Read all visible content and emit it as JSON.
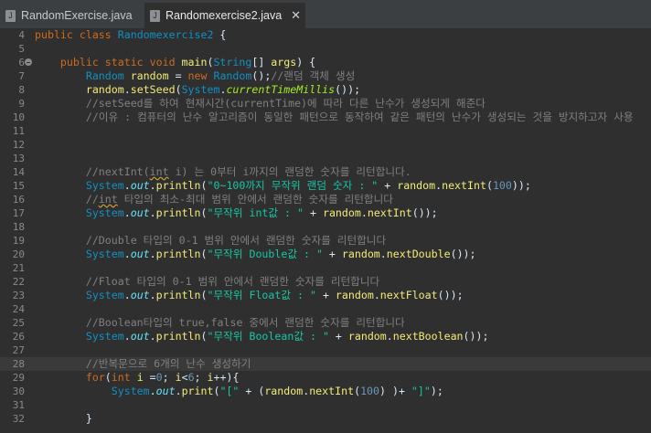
{
  "tabs": [
    {
      "label": "RandomExercise.java",
      "active": false
    },
    {
      "label": "Randomexercise2.java",
      "active": true
    }
  ],
  "colors": {
    "keyword": "#cc6c1d",
    "type": "#1290c3",
    "comment": "#808080",
    "string": "#17c6a3",
    "number": "#6897bb",
    "variable": "#f3ec79",
    "static_field": "#66e1f8",
    "static_method": "#a7ec21"
  },
  "editor": {
    "current_line": 28,
    "fold_marker_line": 6,
    "lines": [
      {
        "n": "4",
        "t": [
          [
            "kw",
            "public class "
          ],
          [
            "ty",
            "Randomexercise2"
          ],
          [
            "pl",
            " {"
          ]
        ]
      },
      {
        "n": "5",
        "t": []
      },
      {
        "n": "6",
        "t": [
          [
            "kw",
            "    public static void "
          ],
          [
            "va",
            "main"
          ],
          [
            "pl",
            "("
          ],
          [
            "ty",
            "String"
          ],
          [
            "pl",
            "[] "
          ],
          [
            "va",
            "args"
          ],
          [
            "pl",
            ") {"
          ]
        ]
      },
      {
        "n": "7",
        "t": [
          [
            "ty",
            "        Random "
          ],
          [
            "va",
            "random"
          ],
          [
            "pl",
            " = "
          ],
          [
            "kw",
            "new "
          ],
          [
            "ty",
            "Random"
          ],
          [
            "pl",
            "();"
          ],
          [
            "cm",
            "//랜덤 객체 생성"
          ]
        ]
      },
      {
        "n": "8",
        "t": [
          [
            "va",
            "        random"
          ],
          [
            "pl",
            "."
          ],
          [
            "va",
            "setSeed"
          ],
          [
            "pl",
            "("
          ],
          [
            "ty",
            "System"
          ],
          [
            "pl",
            "."
          ],
          [
            "sm",
            "currentTimeMillis"
          ],
          [
            "pl",
            "());"
          ]
        ]
      },
      {
        "n": "9",
        "t": [
          [
            "cm",
            "        //setSeed를 하여 현재시간(currentTime)에 따라 다른 난수가 생성되게 해준다"
          ]
        ]
      },
      {
        "n": "10",
        "t": [
          [
            "cm",
            "        //이유 : 컴퓨터의 난수 알고리즘이 동일한 패턴으로 동작하여 같은 패턴의 난수가 생성되는 것을 방지하고자 사용"
          ]
        ]
      },
      {
        "n": "11",
        "t": []
      },
      {
        "n": "12",
        "t": []
      },
      {
        "n": "13",
        "t": []
      },
      {
        "n": "14",
        "t": [
          [
            "cm",
            "        //nextInt("
          ],
          [
            "cmsq",
            "int"
          ],
          [
            "cm",
            " i) 는 0부터 i까지의 랜덤한 숫자를 리턴합니다."
          ]
        ]
      },
      {
        "n": "15",
        "t": [
          [
            "ty",
            "        System"
          ],
          [
            "pl",
            "."
          ],
          [
            "fd",
            "out"
          ],
          [
            "pl",
            "."
          ],
          [
            "va",
            "println"
          ],
          [
            "pl",
            "("
          ],
          [
            "st",
            "\"0~100까지 무작위 랜덤 숫자 : \""
          ],
          [
            "pl",
            " + "
          ],
          [
            "va",
            "random"
          ],
          [
            "pl",
            "."
          ],
          [
            "va",
            "nextInt"
          ],
          [
            "pl",
            "("
          ],
          [
            "nu",
            "100"
          ],
          [
            "pl",
            "));"
          ]
        ]
      },
      {
        "n": "16",
        "t": [
          [
            "cm",
            "        //"
          ],
          [
            "cmsq",
            "int"
          ],
          [
            "cm",
            " 타입의 최소-최대 범위 안에서 랜덤한 숫자를 리턴합니다"
          ]
        ]
      },
      {
        "n": "17",
        "t": [
          [
            "ty",
            "        System"
          ],
          [
            "pl",
            "."
          ],
          [
            "fd",
            "out"
          ],
          [
            "pl",
            "."
          ],
          [
            "va",
            "println"
          ],
          [
            "pl",
            "("
          ],
          [
            "st",
            "\"무작위 int값 : \""
          ],
          [
            "pl",
            " + "
          ],
          [
            "va",
            "random"
          ],
          [
            "pl",
            "."
          ],
          [
            "va",
            "nextInt"
          ],
          [
            "pl",
            "());"
          ]
        ]
      },
      {
        "n": "18",
        "t": []
      },
      {
        "n": "19",
        "t": [
          [
            "cm",
            "        //Double 타입의 0-1 범위 안에서 랜덤한 숫자를 리턴합니다"
          ]
        ]
      },
      {
        "n": "20",
        "t": [
          [
            "ty",
            "        System"
          ],
          [
            "pl",
            "."
          ],
          [
            "fd",
            "out"
          ],
          [
            "pl",
            "."
          ],
          [
            "va",
            "println"
          ],
          [
            "pl",
            "("
          ],
          [
            "st",
            "\"무작위 Double값 : \""
          ],
          [
            "pl",
            " + "
          ],
          [
            "va",
            "random"
          ],
          [
            "pl",
            "."
          ],
          [
            "va",
            "nextDouble"
          ],
          [
            "pl",
            "());"
          ]
        ]
      },
      {
        "n": "21",
        "t": []
      },
      {
        "n": "22",
        "t": [
          [
            "cm",
            "        //Float 타입의 0-1 범위 안에서 랜덤한 숫자를 리턴합니다"
          ]
        ]
      },
      {
        "n": "23",
        "t": [
          [
            "ty",
            "        System"
          ],
          [
            "pl",
            "."
          ],
          [
            "fd",
            "out"
          ],
          [
            "pl",
            "."
          ],
          [
            "va",
            "println"
          ],
          [
            "pl",
            "("
          ],
          [
            "st",
            "\"무작위 Float값 : \""
          ],
          [
            "pl",
            " + "
          ],
          [
            "va",
            "random"
          ],
          [
            "pl",
            "."
          ],
          [
            "va",
            "nextFloat"
          ],
          [
            "pl",
            "());"
          ]
        ]
      },
      {
        "n": "24",
        "t": []
      },
      {
        "n": "25",
        "t": [
          [
            "cm",
            "        //Boolean타입의 true,false 중에서 랜덤한 숫자를 리턴합니다"
          ]
        ]
      },
      {
        "n": "26",
        "t": [
          [
            "ty",
            "        System"
          ],
          [
            "pl",
            "."
          ],
          [
            "fd",
            "out"
          ],
          [
            "pl",
            "."
          ],
          [
            "va",
            "println"
          ],
          [
            "pl",
            "("
          ],
          [
            "st",
            "\"무작위 Boolean값 : \""
          ],
          [
            "pl",
            " + "
          ],
          [
            "va",
            "random"
          ],
          [
            "pl",
            "."
          ],
          [
            "va",
            "nextBoolean"
          ],
          [
            "pl",
            "());"
          ]
        ]
      },
      {
        "n": "27",
        "t": []
      },
      {
        "n": "28",
        "t": [
          [
            "cm",
            "        //반복문으로 6개의 난수 생성하기"
          ]
        ]
      },
      {
        "n": "29",
        "t": [
          [
            "kw",
            "        for"
          ],
          [
            "pl",
            "("
          ],
          [
            "kw",
            "int "
          ],
          [
            "va",
            "i"
          ],
          [
            "pl",
            " ="
          ],
          [
            "nu",
            "0"
          ],
          [
            "pl",
            "; "
          ],
          [
            "va",
            "i"
          ],
          [
            "pl",
            "<"
          ],
          [
            "nu",
            "6"
          ],
          [
            "pl",
            "; "
          ],
          [
            "va",
            "i"
          ],
          [
            "pl",
            "++){"
          ]
        ]
      },
      {
        "n": "30",
        "t": [
          [
            "ty",
            "            System"
          ],
          [
            "pl",
            "."
          ],
          [
            "fd",
            "out"
          ],
          [
            "pl",
            "."
          ],
          [
            "va",
            "print"
          ],
          [
            "pl",
            "("
          ],
          [
            "st",
            "\"[\""
          ],
          [
            "pl",
            " + ("
          ],
          [
            "va",
            "random"
          ],
          [
            "pl",
            "."
          ],
          [
            "va",
            "nextInt"
          ],
          [
            "pl",
            "("
          ],
          [
            "nu",
            "100"
          ],
          [
            "pl",
            ") )+ "
          ],
          [
            "st",
            "\"]\""
          ],
          [
            "pl",
            ");"
          ]
        ]
      },
      {
        "n": "31",
        "t": []
      },
      {
        "n": "32",
        "t": [
          [
            "pl",
            "        }"
          ]
        ]
      }
    ]
  }
}
